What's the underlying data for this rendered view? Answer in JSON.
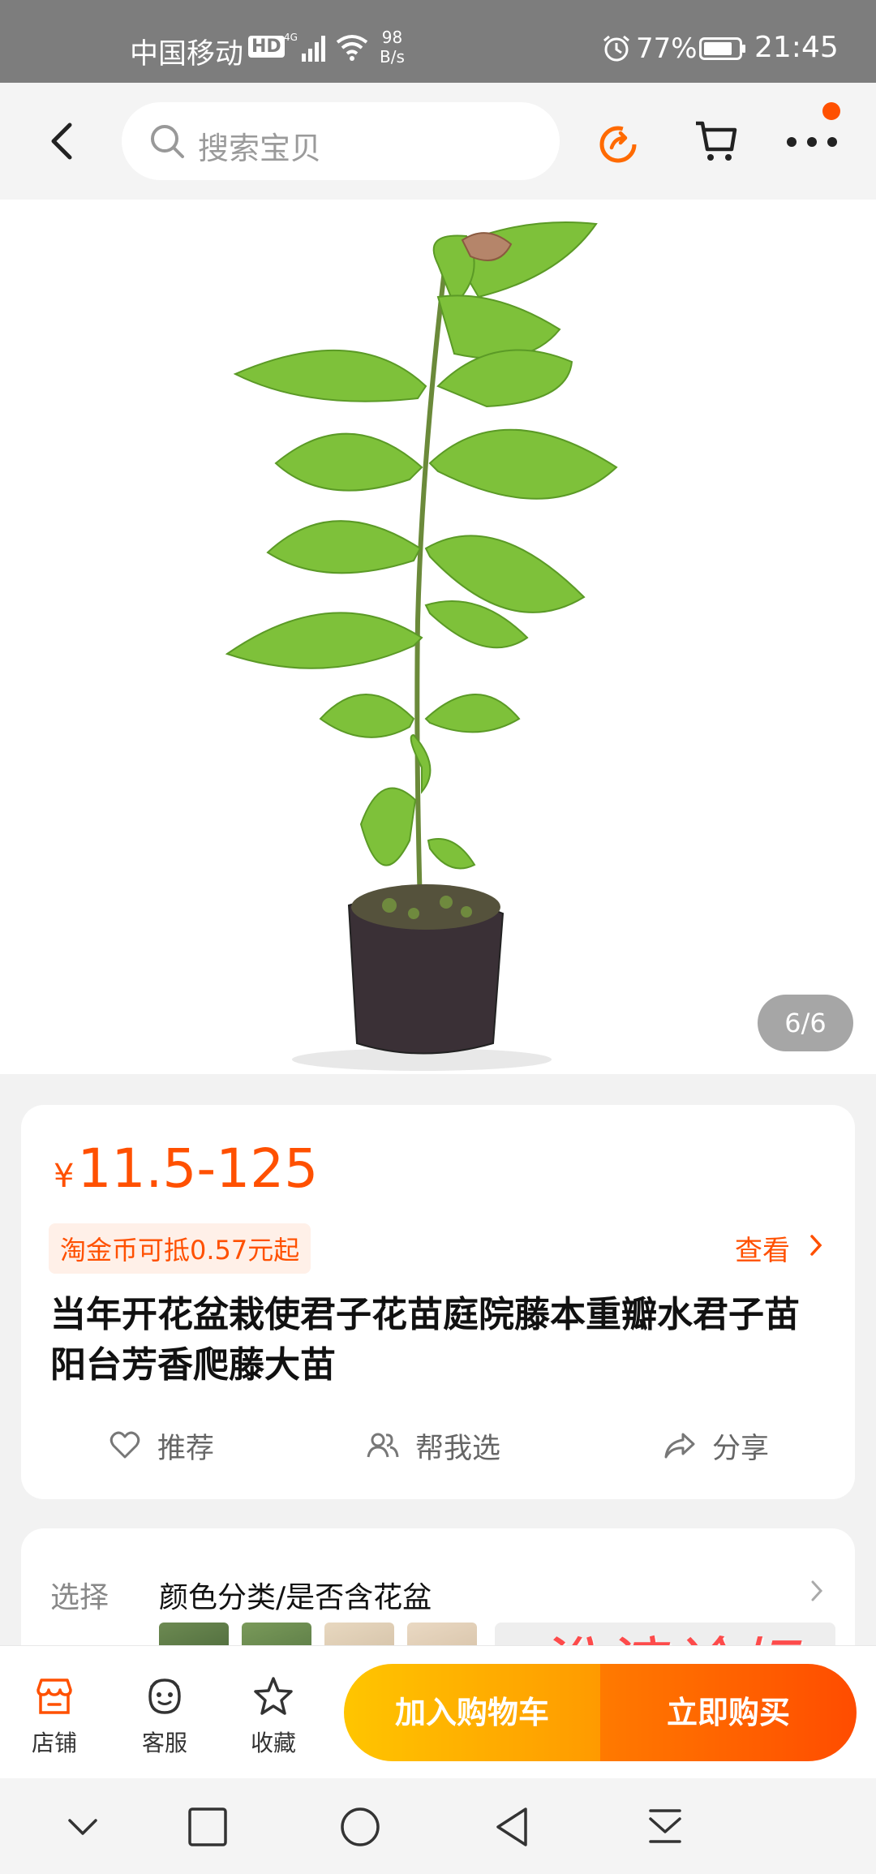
{
  "status_bar": {
    "carrier": "中国移动",
    "hd_badge": "HD",
    "network_type": "4G",
    "net_speed_value": "98",
    "net_speed_unit": "B/s",
    "battery_percent": "77%",
    "time": "21:45"
  },
  "header": {
    "search_placeholder": "搜索宝贝"
  },
  "gallery": {
    "counter": "6/6"
  },
  "product": {
    "currency_symbol": "¥",
    "price": "11.5-125",
    "coin_offer": "淘金币可抵0.57元起",
    "view_label": "查看",
    "title": "当年开花盆栽使君子花苗庭院藤本重瓣水君子苗阳台芳香爬藤大苗",
    "actions": {
      "recommend": "推荐",
      "help_choose": "帮我选",
      "share": "分享"
    }
  },
  "sku": {
    "label": "选择",
    "value": "颜色分类/是否含花盆"
  },
  "watermark": "淮滨论坛",
  "bottom_bar": {
    "store": "店铺",
    "service": "客服",
    "favorite": "收藏",
    "add_to_cart": "加入购物车",
    "buy_now": "立即购买"
  },
  "colors": {
    "accent": "#ff5000",
    "cart_gradient": [
      "#ffc500",
      "#ff9a00"
    ],
    "buy_gradient": [
      "#ff7a00",
      "#ff4c00"
    ],
    "status_bar_bg": "#7d7d7d"
  }
}
